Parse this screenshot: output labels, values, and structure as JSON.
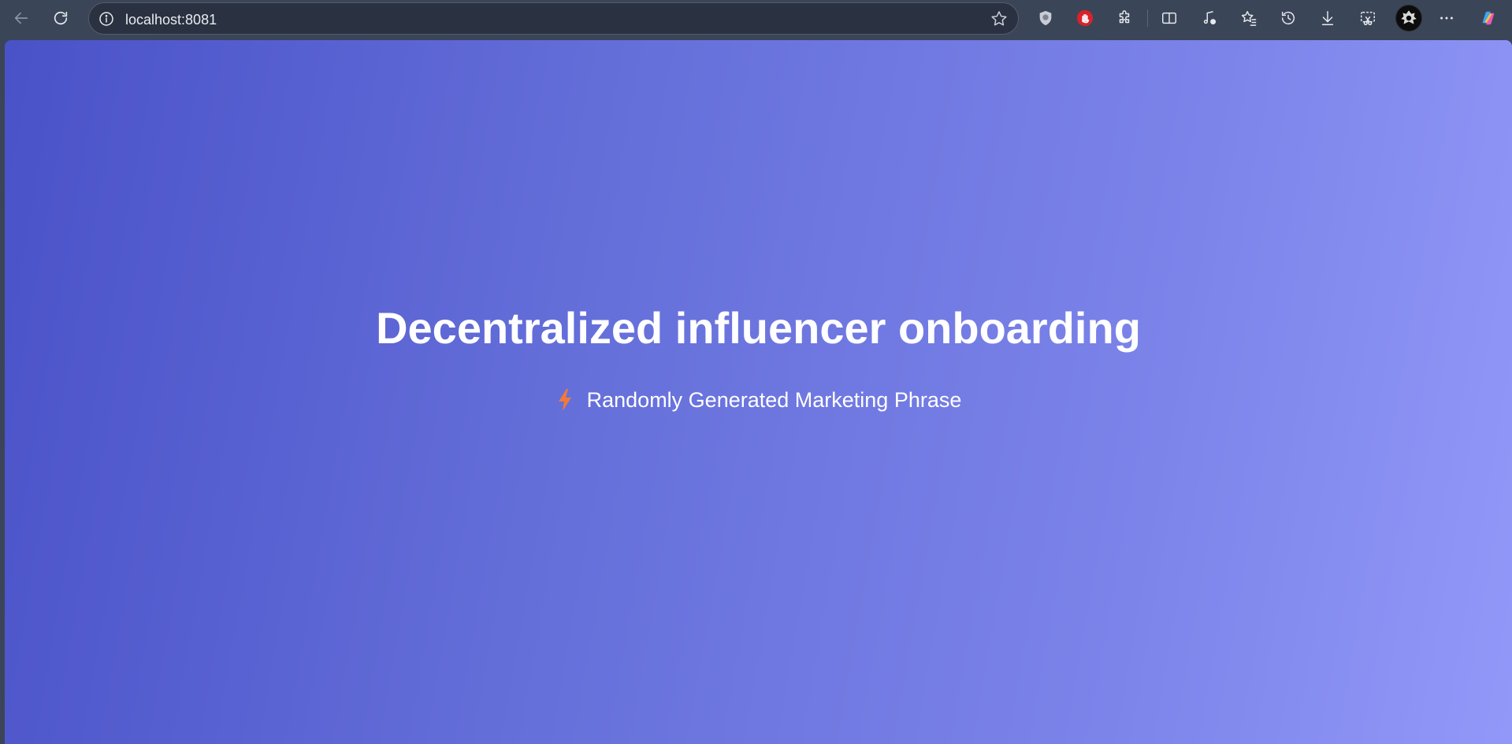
{
  "browser": {
    "url": "localhost:8081"
  },
  "page": {
    "title": "Decentralized influencer onboarding",
    "subtitle": "Randomly Generated Marketing Phrase",
    "subtitle_icon": "lightning-bolt-icon"
  },
  "colors": {
    "gradient_start": "#4a52c8",
    "gradient_end": "#9298f8",
    "toolbar_bg": "#3b4558",
    "bolt": "#f07a3a",
    "text": "#ffffff"
  }
}
